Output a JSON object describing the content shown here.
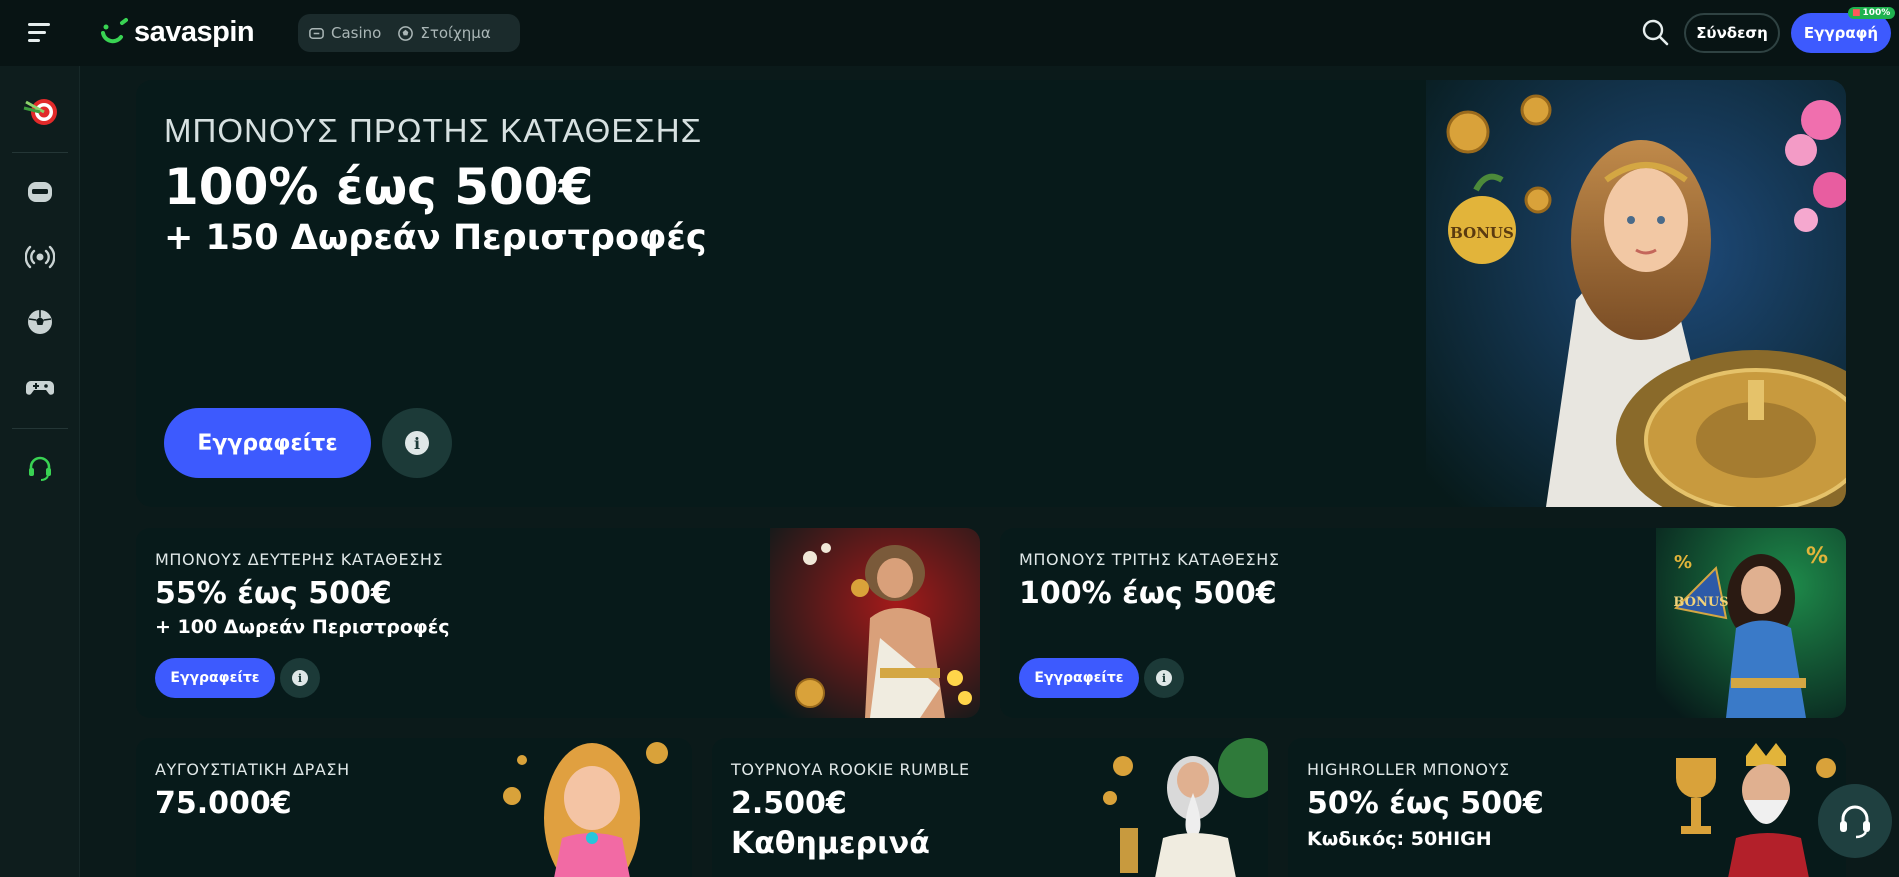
{
  "header": {
    "logo_text": "savaspin",
    "nav": [
      {
        "label": "Casino",
        "icon": "casino-icon"
      },
      {
        "label": "Στοίχημα",
        "icon": "sports-ball-icon"
      }
    ],
    "login_label": "Σύνδεση",
    "register_label": "Εγγραφή",
    "register_badge": "100%",
    "colors": {
      "accent": "#3d5afe",
      "brand_green": "#39d353",
      "badge_green": "#1fb24f"
    }
  },
  "sidebar": {
    "items": [
      {
        "icon": "target-darts-icon"
      },
      {
        "icon": "slot-machine-icon"
      },
      {
        "icon": "live-broadcast-icon"
      },
      {
        "icon": "football-icon"
      },
      {
        "icon": "gamepad-icon"
      },
      {
        "icon": "support-headset-icon"
      }
    ]
  },
  "hero": {
    "kicker": "ΜΠΟΝΟΥΣ ΠΡΩΤΗΣ ΚΑΤΑΘΕΣΗΣ",
    "title": "100% έως 500€",
    "subtitle": "+ 150 Δωρεάν Περιστροφές",
    "cta_label": "Εγγραφείτε",
    "info_label": "i",
    "art_text": "BONUS"
  },
  "promos_row1": [
    {
      "kicker": "ΜΠΟΝΟΥΣ ΔΕΥΤΕΡΗΣ ΚΑΤΑΘΕΣΗΣ",
      "title": "55% έως 500€",
      "subtitle": "+ 100 Δωρεάν Περιστροφές",
      "cta_label": "Εγγραφείτε",
      "info_label": "i"
    },
    {
      "kicker": "ΜΠΟΝΟΥΣ ΤΡΙΤΗΣ ΚΑΤΑΘΕΣΗΣ",
      "title": "100% έως 500€",
      "cta_label": "Εγγραφείτε",
      "info_label": "i",
      "art_text": "BONUS"
    }
  ],
  "promos_row2": [
    {
      "kicker": "ΑΥΓΟΥΣΤΙΑΤΙΚΗ ΔΡΑΣΗ",
      "title": "75.000€"
    },
    {
      "kicker": "ΤΟΥΡΝΟΥΑ ROOKIE RUMBLE",
      "title": "2.500€",
      "title2": "Καθημερινά"
    },
    {
      "kicker": "HIGHROLLER ΜΠΟΝΟΥΣ",
      "title": "50% έως 500€",
      "subtitle": "Κωδικός: 50HIGH"
    }
  ],
  "chat": {
    "icon": "support-chat-icon"
  }
}
